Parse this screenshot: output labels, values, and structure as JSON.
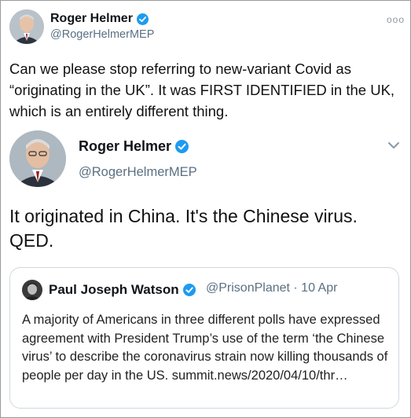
{
  "outer_tweet": {
    "author_name": "Roger Helmer",
    "author_handle": "@RogerHelmerMEP",
    "text": "Can we please stop referring to new-variant Covid as “originating in the UK”. It was FIRST IDENTIFIED in the UK, which is an entirely different thing.",
    "more_icon": "more-dots-icon"
  },
  "reply_tweet": {
    "author_name": "Roger Helmer",
    "author_handle": "@RogerHelmerMEP",
    "text": "It originated in China.  It's the Chinese virus. QED.",
    "menu_icon": "chevron-down-icon"
  },
  "quoted_tweet": {
    "author_name": "Paul Joseph Watson",
    "author_handle": "@PrisonPlanet · 10 Apr",
    "text": "A majority of Americans in three different polls have expressed agreement with President Trump’s use of the term ‘the Chinese virus’ to describe the coronavirus strain now killing thousands of people per day in the US. summit.news/2020/04/10/thr…"
  },
  "colors": {
    "verified": "#1d9bf0",
    "secondary_text": "#5b7083",
    "border": "#cfd9de"
  }
}
